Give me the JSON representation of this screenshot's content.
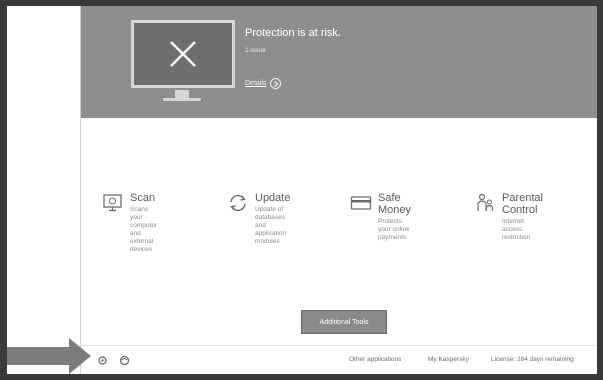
{
  "status": {
    "title": "Protection is at risk.",
    "issues": "1 issue",
    "details_link": "Details"
  },
  "tiles": [
    {
      "title": "Scan",
      "desc": "Scans your computer\nand external devices",
      "icon": "monitor-scan-icon"
    },
    {
      "title": "Update",
      "desc": "Update of databases\nand application\nmodules",
      "icon": "refresh-icon"
    },
    {
      "title": "Safe Money",
      "desc": "Protects your online\npayments",
      "icon": "card-icon"
    },
    {
      "title": "Parental Control",
      "desc": "Internet access\nrestriction",
      "icon": "family-icon"
    }
  ],
  "additional_tools": "Additional Tools",
  "footer": {
    "other_applications": "Other applications",
    "my_kaspersky": "My Kaspersky",
    "license": "License: 284 days remaining",
    "icons": [
      "settings-icon",
      "support-icon"
    ]
  },
  "colors": {
    "banner": "#8e8e8e",
    "frame": "#3a3a3a",
    "button": "#8a8a8a"
  }
}
